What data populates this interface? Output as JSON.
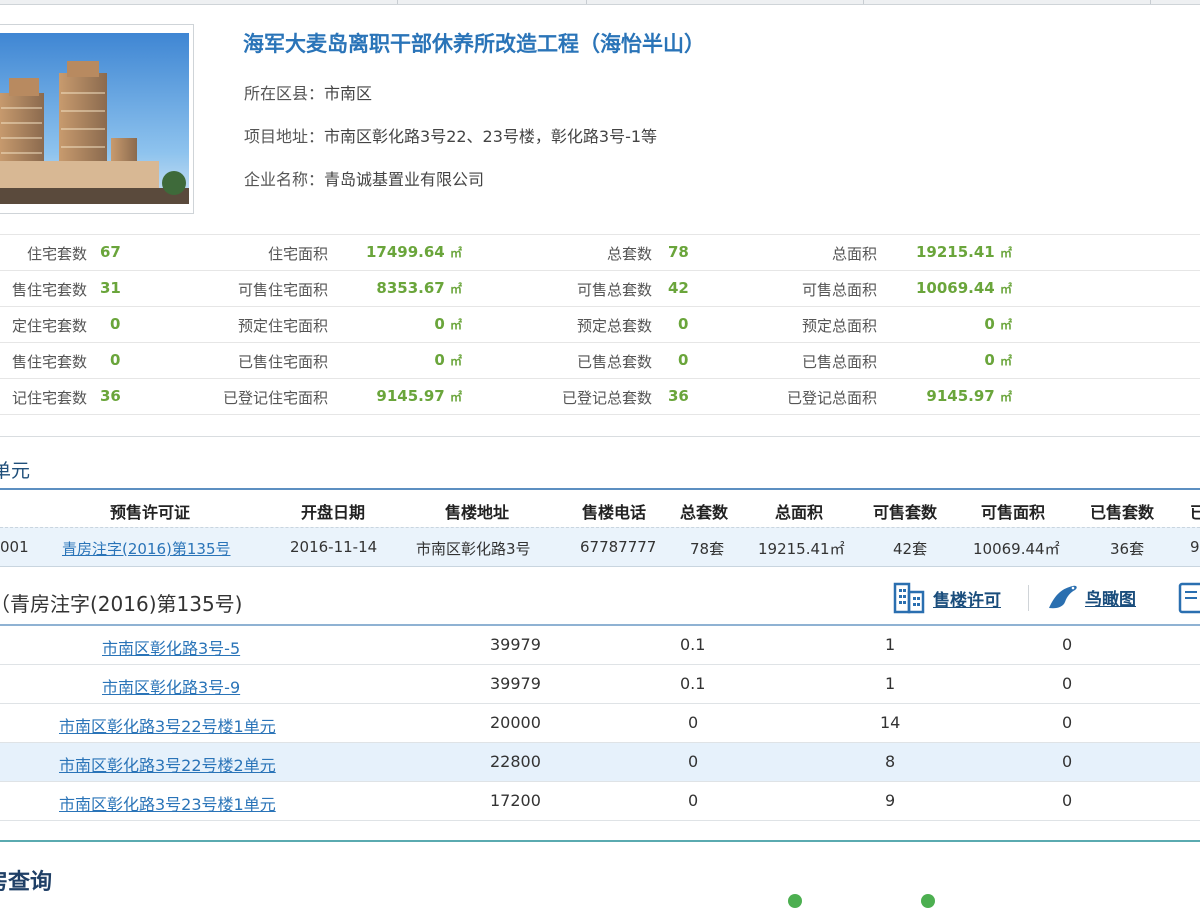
{
  "project": {
    "title": "海军大麦岛离职干部休养所改造工程（海怡半山）",
    "district_label": "所在区县：",
    "district": "市南区",
    "address_label": "项目地址：",
    "address": "市南区彰化路3号22、23号楼，彰化路3号-1等",
    "company_label": "企业名称：",
    "company": "青岛诚基置业有限公司"
  },
  "stats": {
    "unit": "㎡",
    "rows": [
      {
        "l1": "住宅套数",
        "v1": "67",
        "l2": "住宅面积",
        "v2": "17499.64",
        "l3": "总套数",
        "v3": "78",
        "l4": "总面积",
        "v4": "19215.41"
      },
      {
        "l1": "售住宅套数",
        "v1": "31",
        "l2": "可售住宅面积",
        "v2": "8353.67",
        "l3": "可售总套数",
        "v3": "42",
        "l4": "可售总面积",
        "v4": "10069.44"
      },
      {
        "l1": "定住宅套数",
        "v1": "0",
        "l2": "预定住宅面积",
        "v2": "0",
        "l3": "预定总套数",
        "v3": "0",
        "l4": "预定总面积",
        "v4": "0"
      },
      {
        "l1": "售住宅套数",
        "v1": "0",
        "l2": "已售住宅面积",
        "v2": "0",
        "l3": "已售总套数",
        "v3": "0",
        "l4": "已售总面积",
        "v4": "0"
      },
      {
        "l1": "记住宅套数",
        "v1": "36",
        "l2": "已登记住宅面积",
        "v2": "9145.97",
        "l3": "已登记总套数",
        "v3": "36",
        "l4": "已登记总面积",
        "v4": "9145.97"
      }
    ]
  },
  "section_title": "单元",
  "presale": {
    "headers": [
      "预售许可证",
      "开盘日期",
      "售楼地址",
      "售楼电话",
      "总套数",
      "总面积",
      "可售套数",
      "可售面积",
      "已售套数",
      "已"
    ],
    "row": {
      "id_tail": "001",
      "permit": "青房注字(2016)第135号",
      "open_date": "2016-11-14",
      "address": "市南区彰化路3号",
      "phone": "67787777",
      "total": "78套",
      "area": "19215.41㎡",
      "available": "42套",
      "available_area": "10069.44㎡",
      "sold": "36套",
      "extra": "9"
    }
  },
  "permit_section": {
    "title": "（青房注字(2016)第135号)",
    "tools": [
      {
        "label": "售楼许可",
        "icon": "building-icon"
      },
      {
        "label": "鸟瞰图",
        "icon": "bird-icon"
      }
    ]
  },
  "units": [
    {
      "name": "市南区彰化路3号-5",
      "price": "39979",
      "c3": "0.1",
      "c4": "1",
      "c5": "0"
    },
    {
      "name": "市南区彰化路3号-9",
      "price": "39979",
      "c3": "0.1",
      "c4": "1",
      "c5": "0"
    },
    {
      "name": "市南区彰化路3号22号楼1单元",
      "price": "20000",
      "c3": "0",
      "c4": "14",
      "c5": "0"
    },
    {
      "name": "市南区彰化路3号22号楼2单元",
      "price": "22800",
      "c3": "0",
      "c4": "8",
      "c5": "0"
    },
    {
      "name": "市南区彰化路3号23号楼1单元",
      "price": "17200",
      "c3": "0",
      "c4": "9",
      "c5": "0"
    }
  ],
  "bottom_title": "房查询"
}
